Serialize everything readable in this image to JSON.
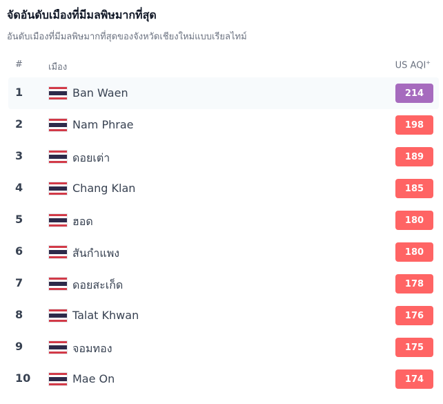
{
  "title": "จัดอันดับเมืองที่มีมลพิษมากที่สุด",
  "subtitle": "อันดับเมืองที่มีมลพิษมากที่สุดของจังหวัดเชียงใหม่แบบเรียลไทม์",
  "header": {
    "rank": "#",
    "city": "เมือง",
    "aqi": "US AQI",
    "aqi_sup": "+"
  },
  "colors": {
    "very_unhealthy": "#a66bbe",
    "unhealthy": "#ff6464"
  },
  "rows": [
    {
      "rank": "1",
      "flag": "thailand-flag-icon",
      "city": "Ban Waen",
      "aqi": "214",
      "level": "very_unhealthy"
    },
    {
      "rank": "2",
      "flag": "thailand-flag-icon",
      "city": "Nam Phrae",
      "aqi": "198",
      "level": "unhealthy"
    },
    {
      "rank": "3",
      "flag": "thailand-flag-icon",
      "city": "ดอยเต่า",
      "aqi": "189",
      "level": "unhealthy"
    },
    {
      "rank": "4",
      "flag": "thailand-flag-icon",
      "city": "Chang Klan",
      "aqi": "185",
      "level": "unhealthy"
    },
    {
      "rank": "5",
      "flag": "thailand-flag-icon",
      "city": "ฮอด",
      "aqi": "180",
      "level": "unhealthy"
    },
    {
      "rank": "6",
      "flag": "thailand-flag-icon",
      "city": "สันกำแพง",
      "aqi": "180",
      "level": "unhealthy"
    },
    {
      "rank": "7",
      "flag": "thailand-flag-icon",
      "city": "ดอยสะเก็ด",
      "aqi": "178",
      "level": "unhealthy"
    },
    {
      "rank": "8",
      "flag": "thailand-flag-icon",
      "city": "Talat Khwan",
      "aqi": "176",
      "level": "unhealthy"
    },
    {
      "rank": "9",
      "flag": "thailand-flag-icon",
      "city": "จอมทอง",
      "aqi": "175",
      "level": "unhealthy"
    },
    {
      "rank": "10",
      "flag": "thailand-flag-icon",
      "city": "Mae On",
      "aqi": "174",
      "level": "unhealthy"
    }
  ]
}
